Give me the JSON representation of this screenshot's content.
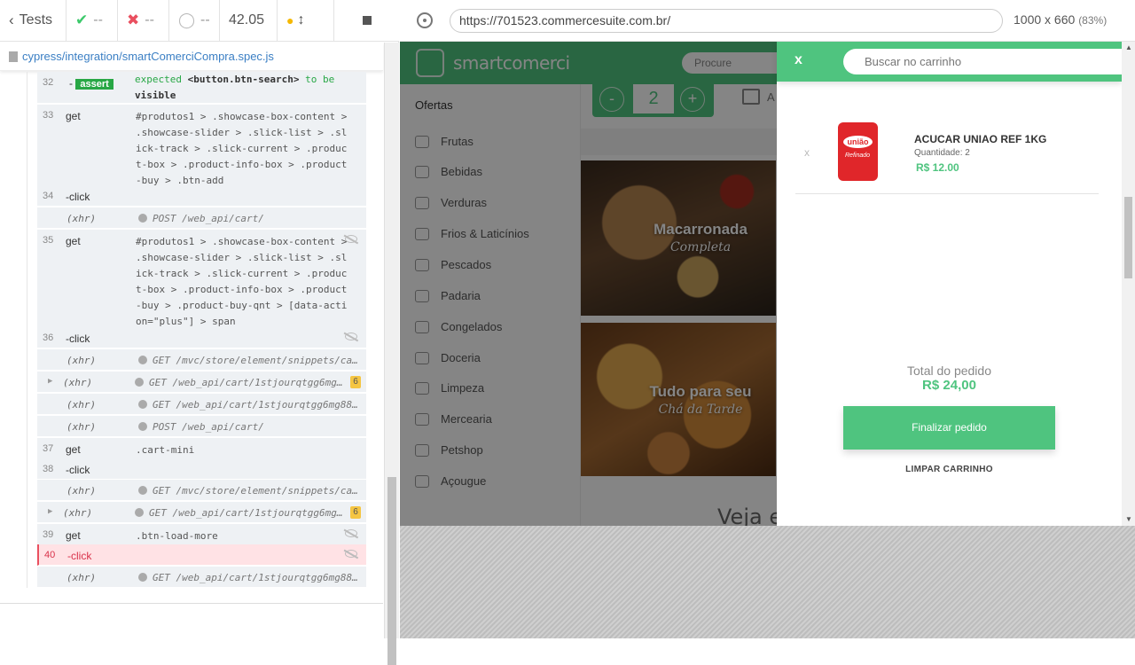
{
  "reporter": {
    "tests_label": "Tests",
    "passed": "--",
    "failed": "--",
    "pending": "--",
    "duration": "42.05",
    "spec_path": "cypress/integration/smartComerciCompra.spec.js",
    "commands": [
      {
        "num": "32",
        "name": "- assert",
        "msg_pre": "expected",
        "msg_code": "<button.btn-search>",
        "msg_mid": "to be",
        "msg_end": "visible"
      },
      {
        "num": "33",
        "name": "get",
        "msg": "#produtos1 > .showcase-box-content > .showcase-slider > .slick-list > .slick-track > .slick-current > .product-box > .product-info-box > .product-buy > .btn-add"
      },
      {
        "num": "34",
        "name": "-click"
      },
      {
        "xhr": "(xhr)",
        "msg": "POST /web_api/cart/"
      },
      {
        "num": "35",
        "name": "get",
        "msg": "#produtos1 > .showcase-box-content > .showcase-slider > .slick-list > .slick-track > .slick-current > .product-box > .product-info-box > .product-buy > .product-buy-qnt > [data-action=\"plus\"] > span"
      },
      {
        "num": "36",
        "name": "-click"
      },
      {
        "xhr": "(xhr)",
        "msg": "GET /mvc/store/element/snippets/ca..."
      },
      {
        "xhr": "(xhr)",
        "msg": "GET /web_api/cart/1stjourqtgg6mg8..."
      },
      {
        "xhr": "(xhr)",
        "msg": "GET /web_api/cart/1stjourqtgg6mg88..."
      },
      {
        "xhr": "(xhr)",
        "msg": "POST /web_api/cart/"
      },
      {
        "num": "37",
        "name": "get",
        "msg": ".cart-mini"
      },
      {
        "num": "38",
        "name": "-click"
      },
      {
        "xhr": "(xhr)",
        "msg": "GET /mvc/store/element/snippets/ca..."
      },
      {
        "xhr": "(xhr)",
        "msg": "GET /web_api/cart/1stjourqtgg6mg8..."
      },
      {
        "num": "39",
        "name": "get",
        "msg": ".btn-load-more"
      },
      {
        "num": "40",
        "name": "-click"
      },
      {
        "xhr": "(xhr)",
        "msg": "GET /web_api/cart/1stjourqtgg6mg88..."
      }
    ],
    "badge": "6"
  },
  "aut": {
    "url": "https://701523.commercesuite.com.br/",
    "size": "1000 x 660",
    "zoom": "(83%)"
  },
  "site": {
    "logo": "smartcomerci",
    "search_placeholder": "Procure",
    "qty_minus": "-",
    "qty_value": "2",
    "qty_plus": "+",
    "cart_letter": "A",
    "ofertas": "Ofertas",
    "categories": [
      "Frutas",
      "Bebidas",
      "Verduras",
      "Frios & Laticínios",
      "Pescados",
      "Padaria",
      "Congelados",
      "Doceria",
      "Limpeza",
      "Mercearia",
      "Petshop",
      "Açougue"
    ],
    "banner1_title": "Macarronada",
    "banner1_sub": "Completa",
    "banner2_title": "Tudo para seu",
    "banner2_sub": "Chá da Tarde",
    "veja": "Veja e"
  },
  "cart": {
    "close": "x",
    "search_placeholder": "Buscar no carrinho",
    "item": {
      "remove": "x",
      "brand": "união",
      "brand_sub": "Refinado",
      "name": "ACUCAR UNIAO REF 1KG",
      "qty": "Quantidade: 2",
      "price": "R$ 12.00"
    },
    "total_label": "Total do pedido",
    "total_value": "R$ 24,00",
    "checkout_label": "Finalizar pedido",
    "clear_label": "LIMPAR CARRINHO"
  },
  "colors": {
    "brand_green": "#4fc47f",
    "fail_red": "#e94f5f"
  }
}
